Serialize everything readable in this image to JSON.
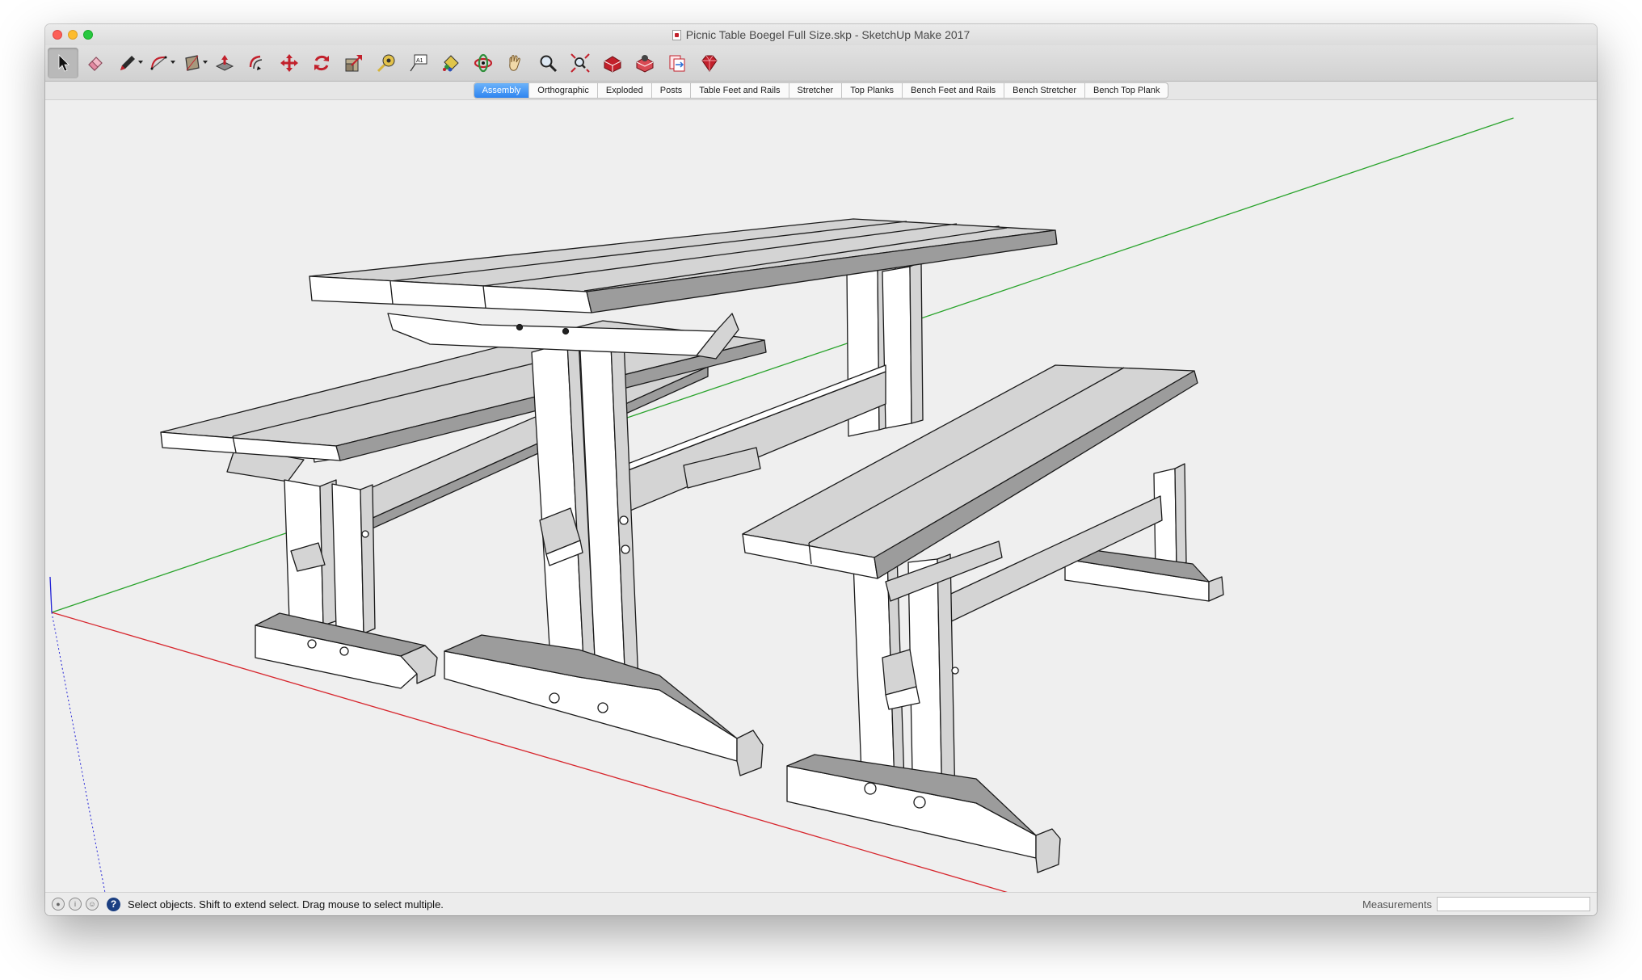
{
  "window": {
    "title": "Picnic Table Boegel Full Size.skp - SketchUp Make 2017"
  },
  "toolbar": {
    "tools": [
      {
        "name": "select-tool",
        "icon": "arrow-cursor-icon",
        "active": true
      },
      {
        "name": "eraser-tool",
        "icon": "eraser-icon"
      },
      {
        "name": "line-tool",
        "icon": "pencil-icon",
        "menu": true
      },
      {
        "name": "arc-tool",
        "icon": "arc-icon",
        "menu": true
      },
      {
        "name": "shapes-tool",
        "icon": "rectangle-icon",
        "menu": true
      },
      {
        "name": "push-pull-tool",
        "icon": "push-pull-icon"
      },
      {
        "name": "offset-tool",
        "icon": "offset-icon"
      },
      {
        "name": "move-tool",
        "icon": "move-icon"
      },
      {
        "name": "rotate-tool",
        "icon": "rotate-icon"
      },
      {
        "name": "scale-tool",
        "icon": "scale-icon"
      },
      {
        "name": "tape-measure-tool",
        "icon": "tape-measure-icon"
      },
      {
        "name": "text-tool",
        "icon": "text-icon"
      },
      {
        "name": "paint-bucket-tool",
        "icon": "paint-bucket-icon"
      },
      {
        "name": "orbit-tool",
        "icon": "orbit-icon"
      },
      {
        "name": "pan-tool",
        "icon": "hand-icon"
      },
      {
        "name": "zoom-tool",
        "icon": "magnifier-icon"
      },
      {
        "name": "zoom-extents-tool",
        "icon": "zoom-extents-icon"
      },
      {
        "name": "3d-warehouse-tool",
        "icon": "warehouse-icon"
      },
      {
        "name": "extension-warehouse-tool",
        "icon": "extension-warehouse-icon"
      },
      {
        "name": "send-to-layout-tool",
        "icon": "layout-icon"
      },
      {
        "name": "extension-manager-tool",
        "icon": "ruby-icon"
      }
    ]
  },
  "scenes": {
    "selected": "Assembly",
    "tabs": [
      "Assembly",
      "Orthographic",
      "Exploded",
      "Posts",
      "Table Feet and Rails",
      "Stretcher",
      "Top Planks",
      "Bench Feet and Rails",
      "Bench Stretcher",
      "Bench Top Plank"
    ]
  },
  "status": {
    "text": "Select objects. Shift to extend select. Drag mouse to select multiple.",
    "help": "?",
    "measurements_label": "Measurements",
    "measurements_value": ""
  },
  "colors": {
    "red_axis": "#d7262d",
    "green_axis": "#29a32b",
    "blue_axis": "#2424d6",
    "face_light": "#ffffff",
    "face_mid": "#d4d4d4",
    "face_dark": "#9c9c9c",
    "edge": "#1a1a1a",
    "scene_tab_selected": "#2e84f0"
  }
}
